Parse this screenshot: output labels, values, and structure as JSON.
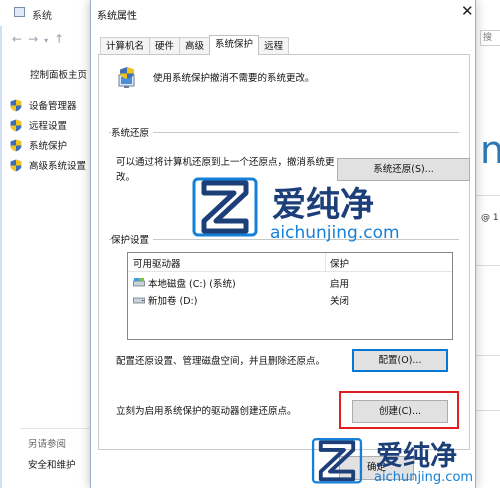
{
  "background_window": {
    "title": "系统",
    "control_panel_home": "控制面板主页",
    "links": [
      {
        "label": "设备管理器",
        "icon": "shield-icon"
      },
      {
        "label": "远程设置",
        "icon": "shield-icon"
      },
      {
        "label": "系统保护",
        "icon": "shield-icon"
      },
      {
        "label": "高级系统设置",
        "icon": "shield-icon"
      }
    ],
    "see_also": "另请参阅",
    "security_maintenance": "安全和维护",
    "right_glyph": "n",
    "right_version": "@ 1",
    "search_hint": "搜"
  },
  "dialog": {
    "title": "系统属性",
    "close_glyph": "✕",
    "tabs": [
      {
        "label": "计算机名"
      },
      {
        "label": "硬件"
      },
      {
        "label": "高级"
      },
      {
        "label": "系统保护",
        "active": true
      },
      {
        "label": "远程"
      }
    ],
    "intro": "使用系统保护撤消不需要的系统更改。",
    "restore": {
      "group_label": "系统还原",
      "description": "可以通过将计算机还原到上一个还原点，撤消系统更改。",
      "button": "系统还原(S)..."
    },
    "protection": {
      "group_label": "保护设置",
      "columns": [
        "可用驱动器",
        "保护"
      ],
      "rows": [
        {
          "drive": "本地磁盘 (C:) (系统)",
          "status": "启用"
        },
        {
          "drive": "新加卷 (D:)",
          "status": "关闭"
        }
      ]
    },
    "configure": {
      "description": "配置还原设置、管理磁盘空间，并且删除还原点。",
      "button": "配置(O)..."
    },
    "create": {
      "description": "立刻为启用系统保护的驱动器创建还原点。",
      "button": "创建(C)..."
    },
    "ok_button": "确定"
  },
  "watermarks": [
    {
      "name": "爱纯净",
      "url": "aichunjing.com"
    },
    {
      "name": "爱纯净",
      "url": "aichunjing.com"
    }
  ],
  "colors": {
    "accent": "#0078d7",
    "highlight": "#e02020",
    "watermark_blue": "#1680d8",
    "watermark_navy": "#1c3f7a"
  }
}
